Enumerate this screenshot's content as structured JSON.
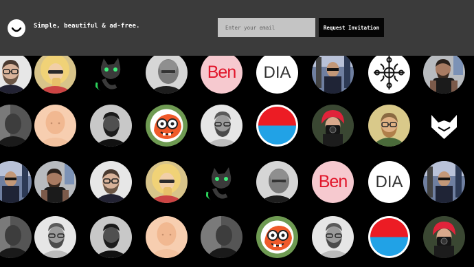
{
  "header": {
    "tagline": "Simple, beautiful & ad-free.",
    "email_placeholder": "Enter your email",
    "request_label": "Request Invitation"
  },
  "avatars": [
    {
      "kind": "photo-man-glasses-beard"
    },
    {
      "kind": "photo-blonde-woman"
    },
    {
      "kind": "cartoon-black-cat"
    },
    {
      "kind": "photo-bald-man-bw"
    },
    {
      "kind": "text-ben"
    },
    {
      "kind": "text-dia"
    },
    {
      "kind": "photo-man-street"
    },
    {
      "kind": "ornament-emblem"
    },
    {
      "kind": "photo-man-tattoo"
    },
    {
      "kind": "photo-man-dark"
    },
    {
      "kind": "photo-bald-man-peach"
    },
    {
      "kind": "photo-man-beard-dark"
    },
    {
      "kind": "cartoon-goggles-face"
    },
    {
      "kind": "photo-man-beard-bw"
    },
    {
      "kind": "red-blue-halves"
    },
    {
      "kind": "photo-red-hair-camera"
    },
    {
      "kind": "photo-man-glasses-sunlit"
    },
    {
      "kind": "white-fox-logo"
    }
  ],
  "labels": {
    "ben": "Ben",
    "dia": "DIA"
  },
  "colors": {
    "header_bg": "#3b3b3b",
    "ben_bg": "#f6c9cf",
    "ben_fg": "#e1162b",
    "dia_bg": "#ffffff",
    "dia_fg": "#333333",
    "goggles_ring": "#6e9a52",
    "halves_top": "#ec1c24",
    "halves_bottom": "#21a2e6"
  }
}
